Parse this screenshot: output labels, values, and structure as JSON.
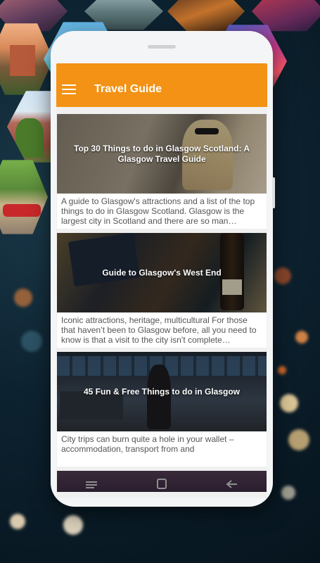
{
  "app": {
    "title": "Travel Guide"
  },
  "articles": [
    {
      "title": "Top 30 Things to do in Glasgow Scotland: A Glasgow Travel Guide",
      "description": "A guide to Glasgow's attractions and a list of the top things to do in Glasgow Scotland. Glasgow is the largest city in Scotland and there are so man…"
    },
    {
      "title": "Guide to Glasgow's West End",
      "description": "Iconic attractions, heritage, multicultural For those that haven’t been to Glasgow before, all you need to know is that a visit to the city isn’t complete…"
    },
    {
      "title": "45 Fun & Free Things to do in Glasgow",
      "description": "City trips can burn quite a hole in your wallet – accommodation, transport from and"
    }
  ],
  "colors": {
    "accent": "#f39214",
    "background": "#06141d"
  },
  "icons": {
    "menu": "menu-icon",
    "recent": "recent-apps-icon",
    "home": "home-icon",
    "back": "back-icon"
  }
}
